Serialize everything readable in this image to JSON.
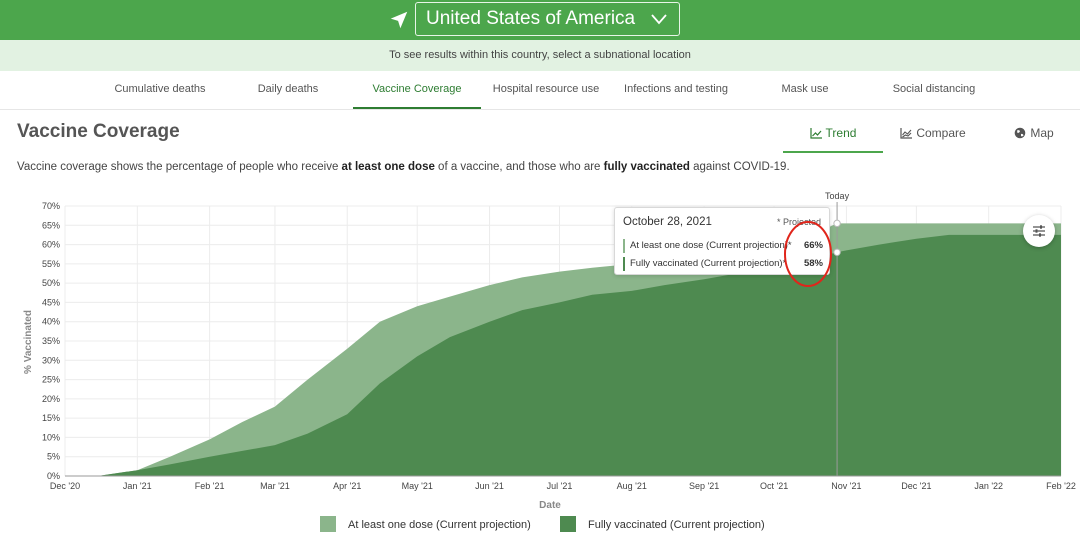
{
  "header": {
    "location": "United States of America",
    "subnational_note": "To see results within this country, select a subnational location"
  },
  "tabs": [
    "Cumulative deaths",
    "Daily deaths",
    "Vaccine Coverage",
    "Hospital resource use",
    "Infections and testing",
    "Mask use",
    "Social distancing"
  ],
  "active_tab": "Vaccine Coverage",
  "page_title": "Vaccine Coverage",
  "view_tabs": {
    "trend": "Trend",
    "compare": "Compare",
    "map": "Map",
    "active": "Trend"
  },
  "description": {
    "p1": "Vaccine coverage shows the percentage of people who receive ",
    "b1": "at least one dose",
    "p2": " of a vaccine, and those who are ",
    "b2": "fully vaccinated",
    "p3": " against COVID-19."
  },
  "colors": {
    "brand": "#4ca64c",
    "at_least_one": "#8bb58b",
    "fully": "#4e8a50",
    "accent": "#2e7d32"
  },
  "chart_data": {
    "type": "area",
    "xlabel": "Date",
    "ylabel": "% Vaccinated",
    "ylim": [
      0,
      70
    ],
    "yticks": [
      "0%",
      "5%",
      "10%",
      "15%",
      "20%",
      "25%",
      "30%",
      "35%",
      "40%",
      "45%",
      "50%",
      "55%",
      "60%",
      "65%",
      "70%"
    ],
    "xticks": [
      "Dec '20",
      "Jan '21",
      "Feb '21",
      "Mar '21",
      "Apr '21",
      "May '21",
      "Jun '21",
      "Jul '21",
      "Aug '21",
      "Sep '21",
      "Oct '21",
      "Nov '21",
      "Dec '21",
      "Jan '22",
      "Feb '22"
    ],
    "x_dates": [
      "2020-12-01",
      "2020-12-15",
      "2021-01-01",
      "2021-01-15",
      "2021-02-01",
      "2021-02-15",
      "2021-03-01",
      "2021-03-15",
      "2021-04-01",
      "2021-04-15",
      "2021-05-01",
      "2021-05-15",
      "2021-06-01",
      "2021-06-15",
      "2021-07-01",
      "2021-07-15",
      "2021-08-01",
      "2021-08-15",
      "2021-09-01",
      "2021-09-15",
      "2021-10-01",
      "2021-10-15",
      "2021-10-28",
      "2021-11-01",
      "2021-11-15",
      "2021-12-01",
      "2021-12-15",
      "2022-01-01",
      "2022-01-15",
      "2022-02-01"
    ],
    "series": [
      {
        "name": "At least one dose (Current projection)",
        "values": [
          0,
          0,
          1.5,
          5,
          9.5,
          14,
          18,
          25,
          33,
          40,
          44,
          46.5,
          49.5,
          51.5,
          53,
          54,
          55,
          56,
          57,
          58.5,
          60,
          62,
          65.5,
          65.5,
          65.5,
          65.5,
          65.5,
          65.5,
          65.5,
          65.5
        ]
      },
      {
        "name": "Fully vaccinated (Current projection)",
        "values": [
          0,
          0,
          1.5,
          3,
          5,
          6.5,
          8,
          11,
          16,
          24,
          31,
          36,
          40,
          43,
          45,
          47,
          48,
          49.5,
          51,
          52.5,
          54,
          56,
          58,
          58.5,
          60,
          61.5,
          62.5,
          62.5,
          62.5,
          62.5
        ]
      }
    ],
    "today_label": "Today",
    "today_date": "2021-10-28",
    "grid": true,
    "legend_position": "bottom",
    "tooltip": {
      "date": "October 28, 2021",
      "note": "* Projected",
      "rows": [
        {
          "label": "At least one dose (Current projection)*",
          "value": "66%"
        },
        {
          "label": "Fully vaccinated (Current projection)*",
          "value": "58%"
        }
      ]
    },
    "annotation": "red circle around tooltip values"
  }
}
